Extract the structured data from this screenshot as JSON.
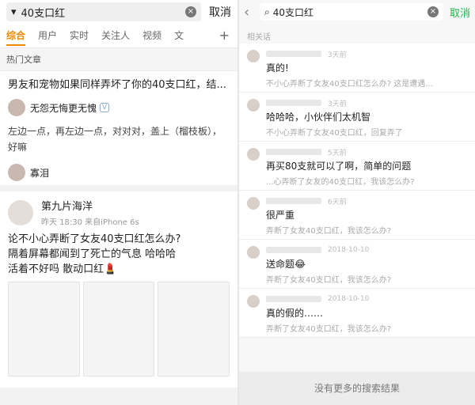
{
  "left": {
    "search": {
      "query": "40支口红",
      "cancel": "取消"
    },
    "tabs": [
      "综合",
      "用户",
      "实时",
      "关注人",
      "视频",
      "文"
    ],
    "section_title": "热门文章",
    "article": {
      "title": "男友和宠物如果同样弄坏了你的40支口红，结...",
      "author": "无怨无悔更无愧",
      "body": "左边一点，再左边一点，对对对，盖上（榴枝板），好嘛",
      "footer_user": "寡泪"
    },
    "post": {
      "user": "第九片海洋",
      "meta": "昨天 18:30 来自iPhone 6s",
      "lines": [
        "论不小心弄断了女友40支口红怎么办?",
        "隔着屏幕都闻到了死亡的气息 哈哈哈",
        "活着不好吗 散动口红💄"
      ]
    }
  },
  "right": {
    "search": {
      "query": "40支口红",
      "cancel": "取消"
    },
    "section_title": "相关话",
    "comments": [
      {
        "time": "3天前",
        "text": "真的!",
        "ref": "不小心弄断了女友40支口红怎么办? 这是遭遇..."
      },
      {
        "time": "3天前",
        "text": "哈哈哈，小伙伴们太机智",
        "ref": "不小心弄断了女友40支口红，回复弄了"
      },
      {
        "time": "5天前",
        "text": "再买80支就可以了啊，简单的问题",
        "ref": "...心弄断了女友的40支口红，我该怎么办?"
      },
      {
        "time": "6天前",
        "text": "很严重",
        "ref": "弄断了女友40支口红，我该怎么办?"
      },
      {
        "time": "2018-10-10",
        "text": "送命题😂",
        "ref": "弄断了女友40支口红，我该怎么办?"
      },
      {
        "time": "2018-10-10",
        "text": "真的假的……",
        "ref": "弄断了女友40支口红，我该怎么办?"
      }
    ],
    "footer": "没有更多的搜索结果"
  }
}
